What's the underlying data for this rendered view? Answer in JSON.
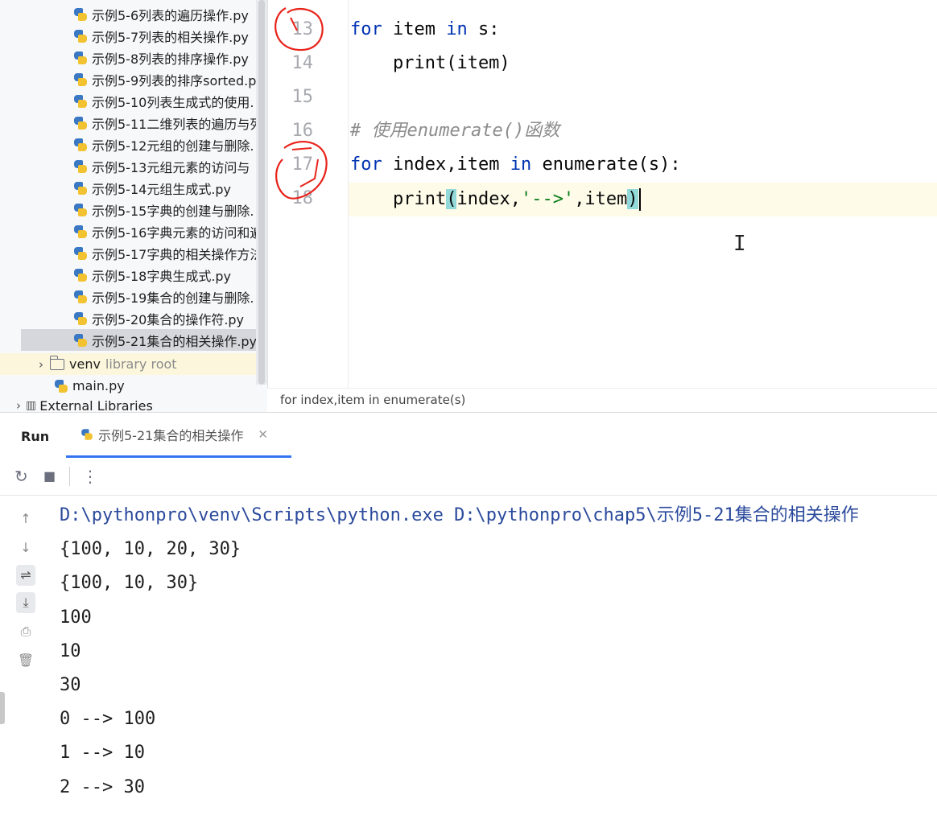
{
  "project_tree": {
    "files": [
      "示例5-6列表的遍历操作.py",
      "示例5-7列表的相关操作.py",
      "示例5-8列表的排序操作.py",
      "示例5-9列表的排序sorted.p",
      "示例5-10列表生成式的使用.",
      "示例5-11二维列表的遍历与列",
      "示例5-12元组的创建与删除.",
      "示例5-13元组元素的访问与",
      "示例5-14元组生成式.py",
      "示例5-15字典的创建与删除.",
      "示例5-16字典元素的访问和遍",
      "示例5-17字典的相关操作方法",
      "示例5-18字典生成式.py",
      "示例5-19集合的创建与删除.",
      "示例5-20集合的操作符.py",
      "示例5-21集合的相关操作.py"
    ],
    "selected_index": 15,
    "venv": {
      "name": "venv",
      "note": "library root"
    },
    "main_file": "main.py",
    "external_libraries": "External Libraries"
  },
  "editor": {
    "line_numbers": [
      "13",
      "14",
      "15",
      "16",
      "17",
      "18"
    ],
    "line13": {
      "kw1": "for",
      "mid": " item ",
      "kw2": "in",
      "rest": " s:"
    },
    "line14": {
      "code": "    print(item)"
    },
    "line16": {
      "comment": "# 使用enumerate()函数"
    },
    "line17": {
      "kw1": "for",
      "mid": " index,item ",
      "kw2": "in",
      "rest": " enumerate(s):"
    },
    "line18": {
      "indent": "    print",
      "open": "(",
      "args1": "index,",
      "str": "'-->'",
      "args2": ",item",
      "close": ")"
    },
    "breadcrumb": "for index,item in enumerate(s)"
  },
  "run_panel": {
    "title": "Run",
    "tab_label": "示例5-21集合的相关操作",
    "console": [
      "D:\\pythonpro\\venv\\Scripts\\python.exe D:\\pythonpro\\chap5\\示例5-21集合的相关操作",
      "{100, 10, 20, 30}",
      "{100, 10, 30}",
      "100",
      "10",
      "30",
      "0 --> 100",
      "1 --> 10",
      "2 --> 30"
    ]
  },
  "icons": {
    "rerun": "rerun-icon",
    "stop": "stop-icon",
    "more": "more-icon",
    "up": "arrow-up-icon",
    "down": "arrow-down-icon",
    "wrap": "soft-wrap-icon",
    "scroll_end": "scroll-to-end-icon",
    "print": "print-icon",
    "trash": "trash-icon"
  },
  "colors": {
    "keyword": "#0033b3",
    "string": "#067d17",
    "comment": "#8c8c8c",
    "annotation": "#e8231a",
    "tab_underline": "#3574f0"
  }
}
